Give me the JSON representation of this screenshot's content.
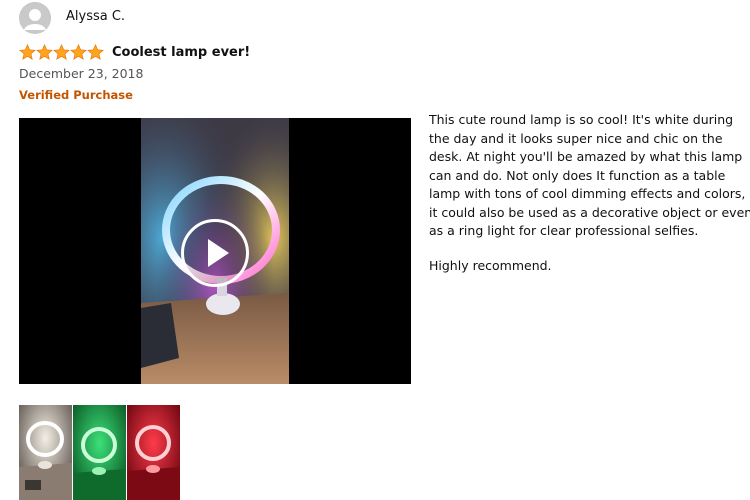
{
  "review": {
    "reviewer_name": "Alyssa C.",
    "rating": 5,
    "rating_max": 5,
    "title": "Coolest lamp ever!",
    "date": "December 23, 2018",
    "verified_label": "Verified Purchase",
    "body_lines": [
      "This cute round lamp is so cool! It's white during",
      "the day and it looks super nice and chic on the",
      "desk. At night you'll be amazed by what this lamp",
      "can and do. Not only does It function as a table",
      "lamp with tons of cool dimming effects and colors,",
      "it could also be used as a decorative object or even",
      "as a ring light for clear professional selfies."
    ],
    "closing_line": "Highly recommend."
  },
  "media": {
    "video_icon": "play-icon",
    "thumbnails": [
      {
        "icon": "white-ring-lamp-image"
      },
      {
        "icon": "green-ring-lamp-image"
      },
      {
        "icon": "red-ring-lamp-image"
      }
    ]
  },
  "colors": {
    "star": "#ffa41c",
    "verified": "#c45500"
  }
}
